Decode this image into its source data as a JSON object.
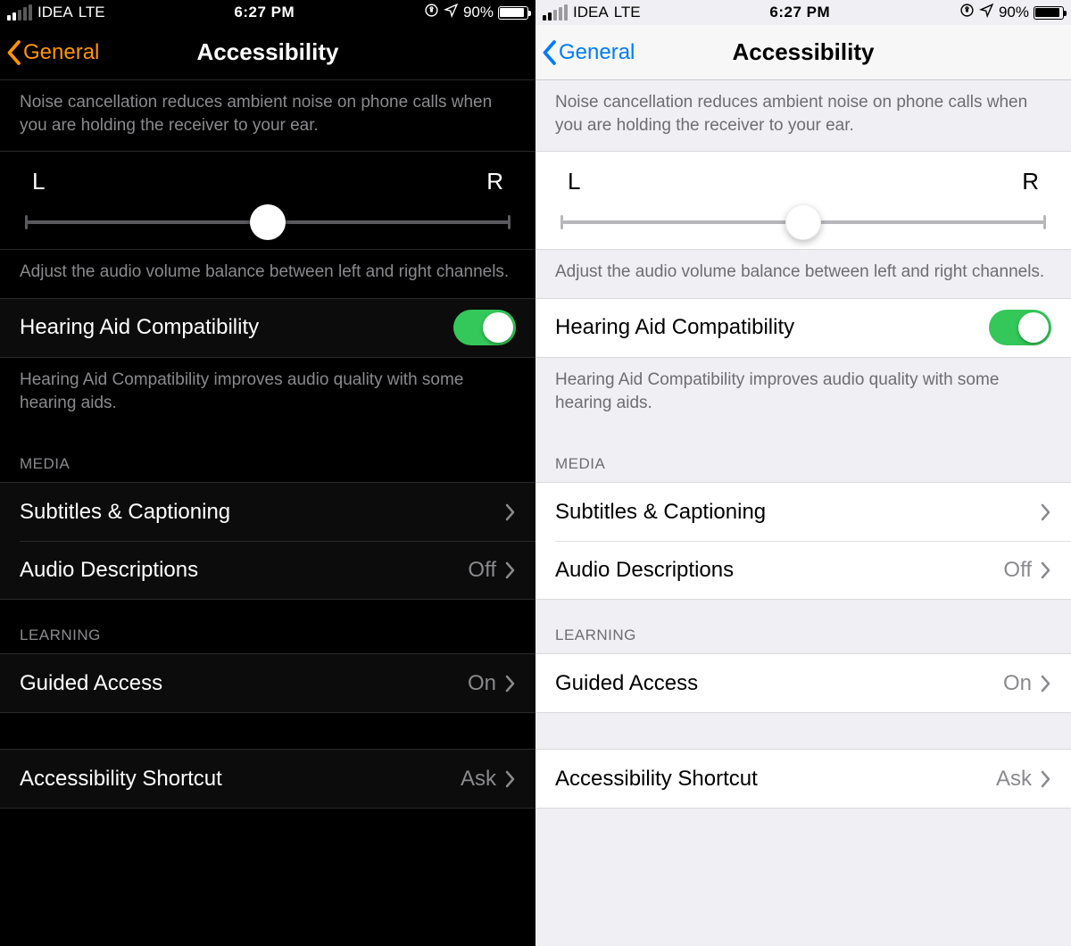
{
  "status": {
    "carrier": "IDEA",
    "network": "LTE",
    "time": "6:27 PM",
    "battery_pct": "90%"
  },
  "nav": {
    "back": "General",
    "title": "Accessibility"
  },
  "noise": {
    "description": "Noise cancellation reduces ambient noise on phone calls when you are holding the receiver to your ear."
  },
  "balance": {
    "left": "L",
    "right": "R",
    "description": "Adjust the audio volume balance between left and right channels."
  },
  "hearing": {
    "label": "Hearing Aid Compatibility",
    "on": true,
    "description": "Hearing Aid Compatibility improves audio quality with some hearing aids."
  },
  "media": {
    "header": "MEDIA",
    "items": [
      {
        "label": "Subtitles & Captioning",
        "value": ""
      },
      {
        "label": "Audio Descriptions",
        "value": "Off"
      }
    ]
  },
  "learning": {
    "header": "LEARNING",
    "items": [
      {
        "label": "Guided Access",
        "value": "On"
      }
    ]
  },
  "shortcut": {
    "label": "Accessibility Shortcut",
    "value": "Ask"
  }
}
